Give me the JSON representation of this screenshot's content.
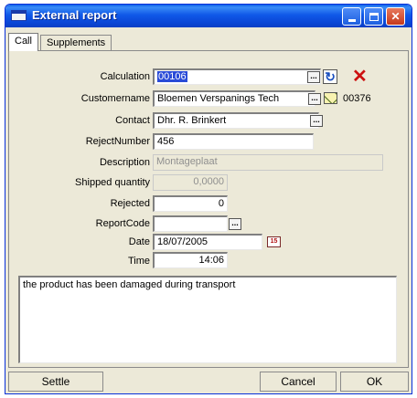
{
  "window": {
    "title": "External report"
  },
  "tabs": [
    {
      "label": "Call"
    },
    {
      "label": "Supplements"
    }
  ],
  "form": {
    "calculation": {
      "label": "Calculation",
      "value": "00106"
    },
    "customername": {
      "label": "Customername",
      "value": "Bloemen Verspanings Tech",
      "code": "00376"
    },
    "contact": {
      "label": "Contact",
      "value": "Dhr. R. Brinkert"
    },
    "reject_number": {
      "label": "RejectNumber",
      "value": "456"
    },
    "description": {
      "label": "Description",
      "value": "Montageplaat"
    },
    "shipped_quantity": {
      "label": "Shipped quantity",
      "value": "0,0000"
    },
    "rejected": {
      "label": "Rejected",
      "value": "0"
    },
    "report_code": {
      "label": "ReportCode",
      "value": ""
    },
    "date": {
      "label": "Date",
      "value": "18/07/2005",
      "calendar_icon_text": "15"
    },
    "time": {
      "label": "Time",
      "value": "14:06"
    }
  },
  "memo": {
    "text": "the product has been damaged during transport"
  },
  "buttons": {
    "settle": "Settle",
    "cancel": "Cancel",
    "ok": "OK",
    "lookup": "..."
  },
  "icons": {
    "lookup": "ellipsis-button-icon",
    "refresh": "refresh-icon",
    "delete": "red-x-icon",
    "mail": "envelope-icon",
    "calendar": "calendar-icon"
  },
  "colors": {
    "titlebar": "#0a46d6",
    "selection": "#2a4bd7",
    "delete_icon": "#cc1010"
  }
}
